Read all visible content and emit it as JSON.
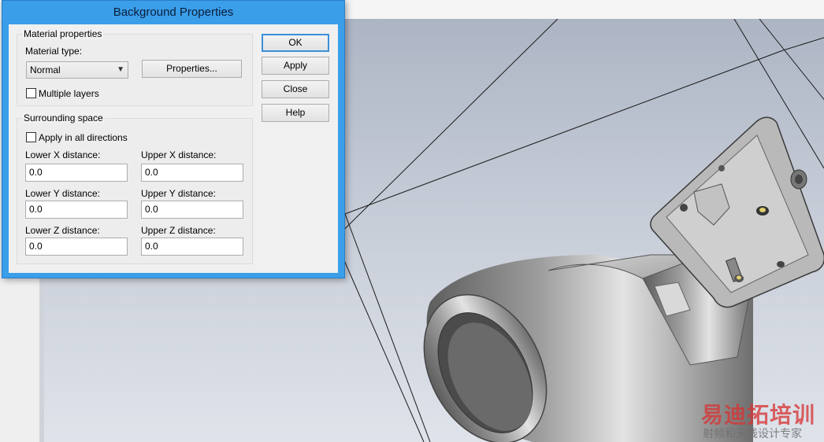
{
  "dialog": {
    "title": "Background Properties",
    "material": {
      "group_label": "Material properties",
      "type_label": "Material type:",
      "type_value": "Normal",
      "properties_button": "Properties...",
      "multiple_layers_label": "Multiple layers",
      "multiple_layers_checked": false
    },
    "surrounding": {
      "group_label": "Surrounding space",
      "apply_all_label": "Apply in all directions",
      "apply_all_checked": false,
      "lower_x_label": "Lower X distance:",
      "lower_x_value": "0.0",
      "upper_x_label": "Upper X distance:",
      "upper_x_value": "0.0",
      "lower_y_label": "Lower Y distance:",
      "lower_y_value": "0.0",
      "upper_y_label": "Upper Y distance:",
      "upper_y_value": "0.0",
      "lower_z_label": "Lower Z distance:",
      "lower_z_value": "0.0",
      "upper_z_label": "Upper Z distance:",
      "upper_z_value": "0.0"
    },
    "buttons": {
      "ok": "OK",
      "apply": "Apply",
      "close": "Close",
      "help": "Help"
    }
  },
  "watermark": {
    "brand": "易迪拓培训",
    "tagline": "射频和天线设计专家"
  },
  "colors": {
    "titlebar": "#3a9ee9",
    "watermark_red": "#d63636"
  }
}
